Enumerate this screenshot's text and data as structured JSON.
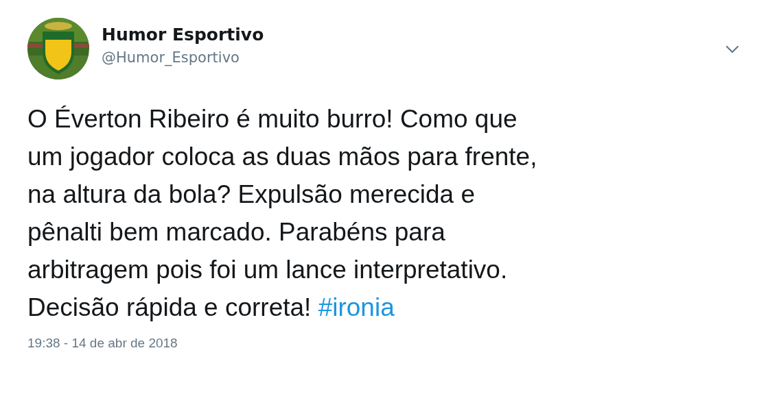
{
  "author": {
    "name": "Humor Esportivo",
    "handle": "@Humor_Esportivo"
  },
  "tweet": {
    "text": "O Éverton Ribeiro é muito burro! Como que\num jogador coloca as duas mãos para frente,\nna altura da bola? Expulsão merecida e\npênalti bem marcado. Parabéns para\narbitragem pois foi um lance interpretativo.\nDecisão rápida e correta! ",
    "hashtag": "#ironia"
  },
  "timestamp": "19:38 - 14 de abr de 2018"
}
